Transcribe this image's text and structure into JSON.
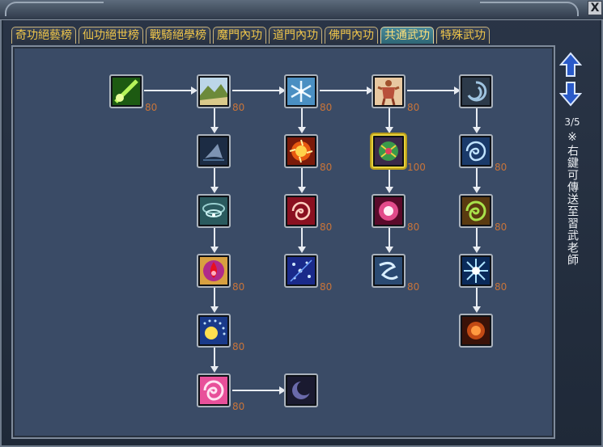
{
  "window": {
    "close_label": "X"
  },
  "tabs": [
    {
      "label": "奇功絕藝榜",
      "active": false
    },
    {
      "label": "仙功絕世榜",
      "active": false
    },
    {
      "label": "戰騎絕學榜",
      "active": false
    },
    {
      "label": "魔門內功",
      "active": false
    },
    {
      "label": "道門內功",
      "active": false
    },
    {
      "label": "佛門內功",
      "active": false
    },
    {
      "label": "共通武功",
      "active": true
    },
    {
      "label": "特殊武功",
      "active": false
    }
  ],
  "skills": [
    {
      "id": "s1",
      "icon": "green-beam-icon",
      "level": "80",
      "selected": false
    },
    {
      "id": "s2",
      "icon": "landscape-icon",
      "level": "80",
      "selected": false
    },
    {
      "id": "s3",
      "icon": "snowflake-icon",
      "level": "80",
      "selected": false
    },
    {
      "id": "s4",
      "icon": "warrior-body-icon",
      "level": "80",
      "selected": false
    },
    {
      "id": "s5",
      "icon": "dark-swirl-icon",
      "level": "",
      "selected": false
    },
    {
      "id": "s6",
      "icon": "shark-fin-icon",
      "level": "",
      "selected": false
    },
    {
      "id": "s7",
      "icon": "fire-burst-icon",
      "level": "80",
      "selected": false
    },
    {
      "id": "s8",
      "icon": "green-orb-icon",
      "level": "100",
      "selected": true
    },
    {
      "id": "s9",
      "icon": "blue-whirl-icon",
      "level": "80",
      "selected": false
    },
    {
      "id": "s10",
      "icon": "teal-vortex-icon",
      "level": "",
      "selected": false
    },
    {
      "id": "s11",
      "icon": "red-spiral-icon",
      "level": "80",
      "selected": false
    },
    {
      "id": "s12",
      "icon": "pink-ring-icon",
      "level": "80",
      "selected": false
    },
    {
      "id": "s13",
      "icon": "green-spiral-icon",
      "level": "80",
      "selected": false
    },
    {
      "id": "s14",
      "icon": "blood-drop-icon",
      "level": "80",
      "selected": false
    },
    {
      "id": "s15",
      "icon": "blue-sparkle-icon",
      "level": "80",
      "selected": false
    },
    {
      "id": "s16",
      "icon": "wind-swirl-icon",
      "level": "80",
      "selected": false
    },
    {
      "id": "s17",
      "icon": "starburst-icon",
      "level": "80",
      "selected": false
    },
    {
      "id": "s18",
      "icon": "golden-sun-icon",
      "level": "80",
      "selected": false
    },
    {
      "id": "s19",
      "icon": "orange-flare-icon",
      "level": "",
      "selected": false
    },
    {
      "id": "s20",
      "icon": "pink-vortex-icon",
      "level": "80",
      "selected": false
    },
    {
      "id": "s21",
      "icon": "purple-crescent-icon",
      "level": "",
      "selected": false
    }
  ],
  "side": {
    "page_indicator": "3/5",
    "hint": "※右鍵可傳送至習武老師",
    "up_icon": "arrow-up-icon",
    "down_icon": "arrow-down-icon"
  },
  "colors": {
    "level_text": "#c8743a",
    "tab_text": "#f0c64a",
    "board_bg": "#3a4b66",
    "selected_border": "#e8d23a"
  }
}
